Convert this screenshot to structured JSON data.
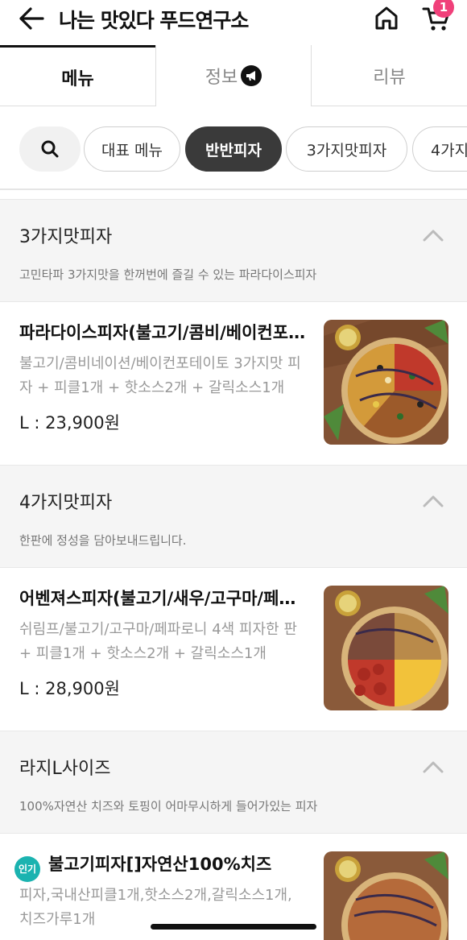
{
  "header": {
    "title": "나는 맛있다 푸드연구소",
    "back_icon": "arrow-left-icon",
    "home_icon": "home-icon",
    "cart_icon": "cart-icon",
    "cart_count": "1"
  },
  "tabs": [
    {
      "label": "메뉴",
      "active": true
    },
    {
      "label": "정보",
      "icon": "megaphone-icon"
    },
    {
      "label": "리뷰"
    }
  ],
  "categories": {
    "search_icon": "search-icon",
    "items": [
      {
        "label": "대표 메뉴"
      },
      {
        "label": "반반피자",
        "active": true
      },
      {
        "label": "3가지맛피자"
      },
      {
        "label": "4가지"
      }
    ]
  },
  "sections": [
    {
      "title": "3가지맛피자",
      "description": "고민타파 3가지맛을 한꺼번에 즐길 수 있는 파라다이스피자",
      "items": [
        {
          "name": "파라다이스피자(불고기/콤비/베이컨포테이토)",
          "description": "불고기/콤비네이션/베이컨포테이토 3가지맛 피자 + 피클1개 + 핫소스2개 + 갈릭소스1개",
          "price": "L : 23,900원"
        }
      ]
    },
    {
      "title": "4가지맛피자",
      "description": "한판에 정성을 담아보내드립니다.",
      "items": [
        {
          "name": "어벤져스피자(불고기/새우/고구마/페파로니)",
          "description": "쉬림프/불고기/고구마/페파로니 4색 피자한 판 + 피클1개 + 핫소스2개 + 갈릭소스1개",
          "price": "L : 28,900원"
        }
      ]
    },
    {
      "title": "라지L사이즈",
      "description": "100%자연산 치즈와 토핑이 어마무시하게 들어가있는 피자",
      "items": [
        {
          "badge": "인기",
          "name": "불고기피자[]자연산100%치즈",
          "description": "피자,국내산피클1개,핫소스2개,갈릭소스1개, 치즈가루1개"
        }
      ]
    }
  ],
  "colors": {
    "badge_pink": "#f0407a",
    "popular_teal": "#1bb3b0",
    "active_chip": "#3a3a3a"
  }
}
